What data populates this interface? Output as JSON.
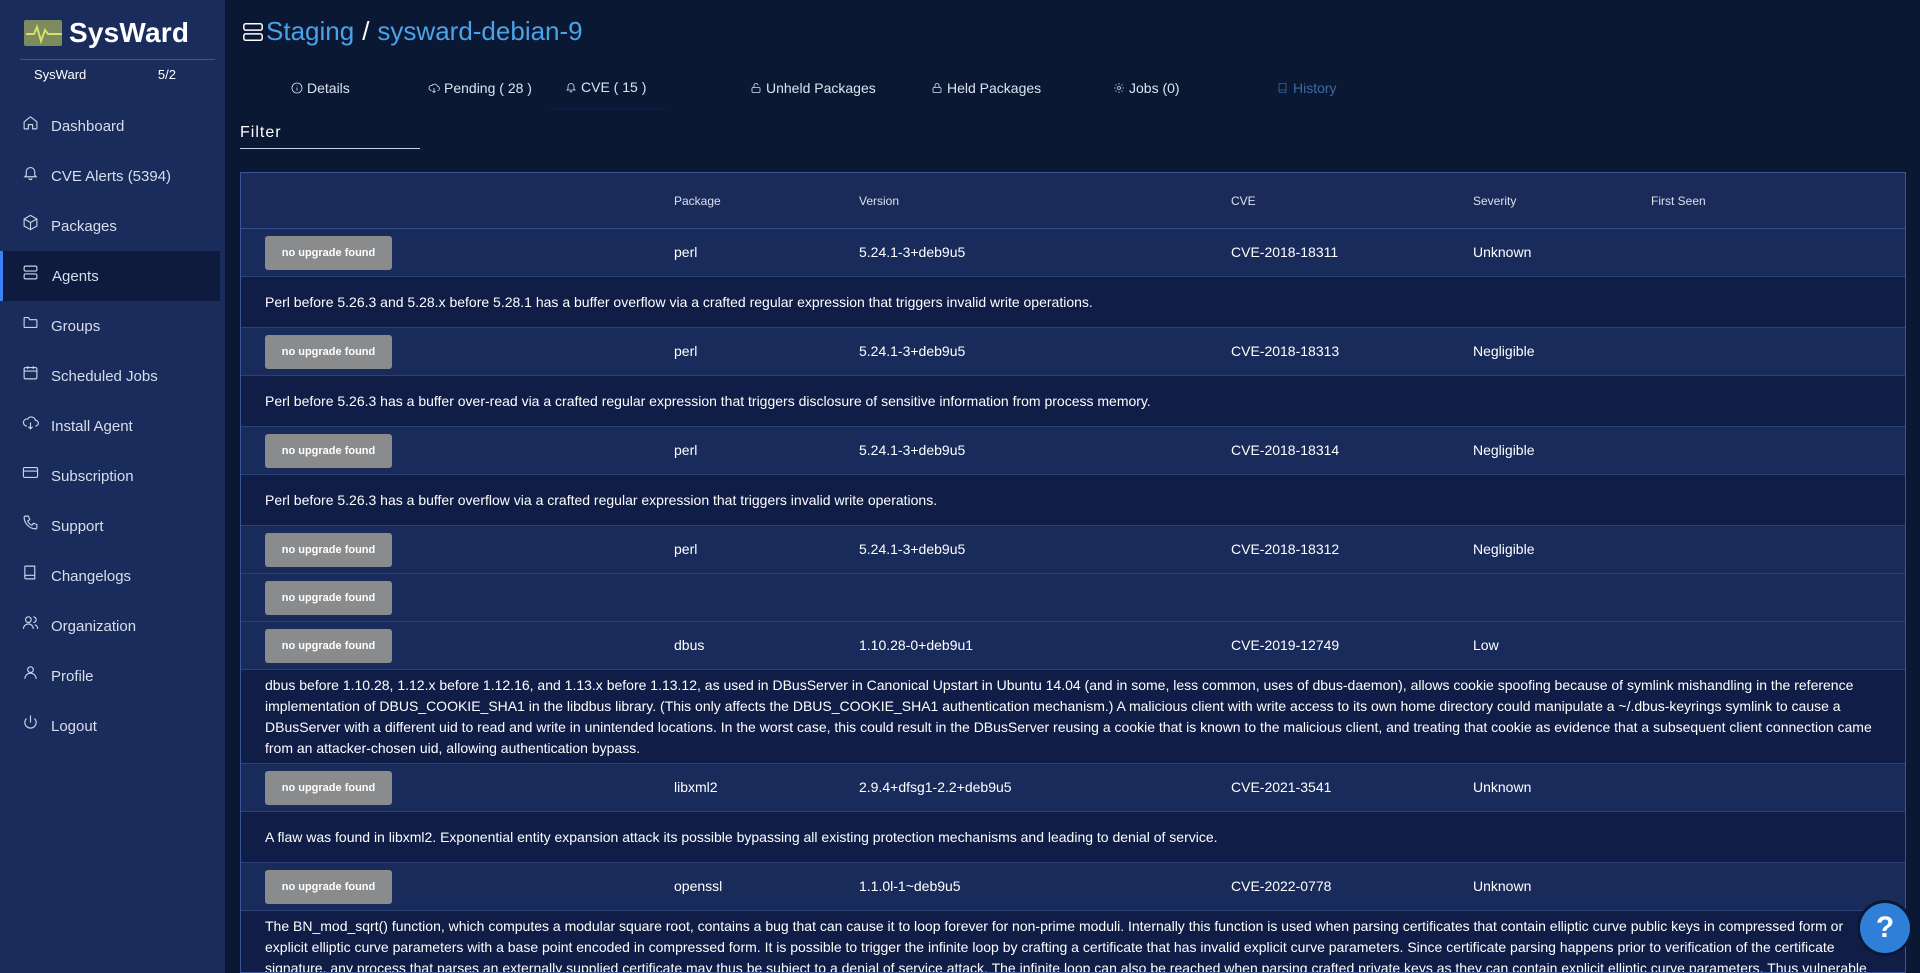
{
  "brand": {
    "name": "SysWard"
  },
  "org": {
    "name": "SysWard",
    "count": "5/2"
  },
  "sidebar": {
    "items": [
      {
        "label": "Dashboard",
        "icon": "home-icon"
      },
      {
        "label": "CVE Alerts (5394)",
        "icon": "bell-icon"
      },
      {
        "label": "Packages",
        "icon": "box-icon"
      },
      {
        "label": "Agents",
        "icon": "server-icon",
        "active": true
      },
      {
        "label": "Groups",
        "icon": "folder-icon"
      },
      {
        "label": "Scheduled Jobs",
        "icon": "calendar-icon"
      },
      {
        "label": "Install Agent",
        "icon": "cloud-download-icon"
      },
      {
        "label": "Subscription",
        "icon": "credit-card-icon"
      },
      {
        "label": "Support",
        "icon": "phone-icon"
      },
      {
        "label": "Changelogs",
        "icon": "book-icon"
      },
      {
        "label": "Organization",
        "icon": "users-icon"
      },
      {
        "label": "Profile",
        "icon": "user-icon"
      },
      {
        "label": "Logout",
        "icon": "power-icon"
      }
    ]
  },
  "header": {
    "group": "Staging",
    "separator": "/",
    "host": "sysward-debian-9"
  },
  "tabs": [
    {
      "label": "Details",
      "icon": "info-icon"
    },
    {
      "label": "Pending ( 28 )",
      "icon": "cloud-download-icon"
    },
    {
      "label": "CVE ( 15 )",
      "icon": "bell-icon",
      "active": true
    },
    {
      "label": "Unheld Packages",
      "icon": "unlock-icon"
    },
    {
      "label": "Held Packages",
      "icon": "lock-icon"
    },
    {
      "label": "Jobs (0)",
      "icon": "gear-icon"
    },
    {
      "label": "History",
      "icon": "book-icon"
    }
  ],
  "filter": {
    "label": "Filter"
  },
  "table": {
    "columns": [
      "",
      "Package",
      "Version",
      "CVE",
      "Severity",
      "First Seen"
    ],
    "button_label": "no upgrade found",
    "rows": [
      {
        "package": "perl",
        "version": "5.24.1-3+deb9u5",
        "cve": "CVE-2018-18311",
        "severity": "Unknown",
        "first_seen": "",
        "description": "Perl before 5.26.3 and 5.28.x before 5.28.1 has a buffer overflow via a crafted regular expression that triggers invalid write operations."
      },
      {
        "package": "perl",
        "version": "5.24.1-3+deb9u5",
        "cve": "CVE-2018-18313",
        "severity": "Negligible",
        "first_seen": "",
        "description": "Perl before 5.26.3 has a buffer over-read via a crafted regular expression that triggers disclosure of sensitive information from process memory."
      },
      {
        "package": "perl",
        "version": "5.24.1-3+deb9u5",
        "cve": "CVE-2018-18314",
        "severity": "Negligible",
        "first_seen": "",
        "description": "Perl before 5.26.3 has a buffer overflow via a crafted regular expression that triggers invalid write operations."
      },
      {
        "package": "perl",
        "version": "5.24.1-3+deb9u5",
        "cve": "CVE-2018-18312",
        "severity": "Negligible",
        "first_seen": ""
      },
      {
        "package": "",
        "version": "",
        "cve": "",
        "severity": "",
        "first_seen": ""
      },
      {
        "package": "dbus",
        "version": "1.10.28-0+deb9u1",
        "cve": "CVE-2019-12749",
        "severity": "Low",
        "first_seen": "",
        "description": "dbus before 1.10.28, 1.12.x before 1.12.16, and 1.13.x before 1.13.12, as used in DBusServer in Canonical Upstart in Ubuntu 14.04 (and in some, less common, uses of dbus-daemon), allows cookie spoofing because of symlink mishandling in the reference implementation of DBUS_COOKIE_SHA1 in the libdbus library. (This only affects the DBUS_COOKIE_SHA1 authentication mechanism.) A malicious client with write access to its own home directory could manipulate a ~/.dbus-keyrings symlink to cause a DBusServer with a different uid to read and write in unintended locations. In the worst case, this could result in the DBusServer reusing a cookie that is known to the malicious client, and treating that cookie as evidence that a subsequent client connection came from an attacker-chosen uid, allowing authentication bypass."
      },
      {
        "package": "libxml2",
        "version": "2.9.4+dfsg1-2.2+deb9u5",
        "cve": "CVE-2021-3541",
        "severity": "Unknown",
        "first_seen": "",
        "description": "A flaw was found in libxml2. Exponential entity expansion attack its possible bypassing all existing protection mechanisms and leading to denial of service."
      },
      {
        "package": "openssl",
        "version": "1.1.0l-1~deb9u5",
        "cve": "CVE-2022-0778",
        "severity": "Unknown",
        "first_seen": "",
        "description": "The BN_mod_sqrt() function, which computes a modular square root, contains a bug that can cause it to loop forever for non-prime moduli. Internally this function is used when parsing certificates that contain elliptic curve public keys in compressed form or explicit elliptic curve parameters with a base point encoded in compressed form. It is possible to trigger the infinite loop by crafting a certificate that has invalid explicit curve parameters. Since certificate parsing happens prior to verification of the certificate signature, any process that parses an externally supplied certificate may thus be subject to a denial of service attack. The infinite loop can also be reached when parsing crafted private keys as they can contain explicit elliptic curve parameters. Thus vulnerable situations include: - TLS clients consuming server certificates - TLS servers consuming client certificates - Hosting providers taking certificates or private keys from customers - Certificate authorities parsing certification requests from subscribers - Anything else"
      }
    ]
  },
  "help": {
    "label": "?"
  }
}
